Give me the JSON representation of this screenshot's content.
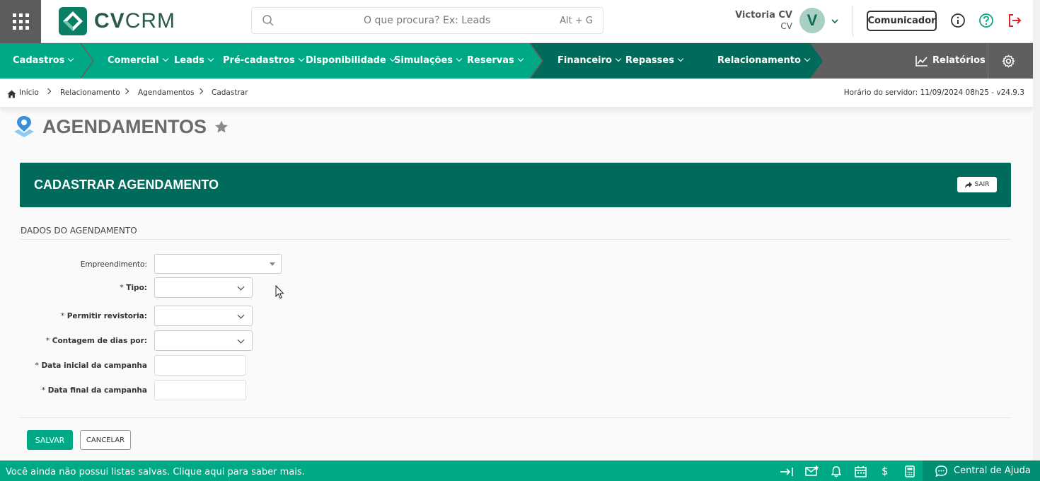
{
  "header": {
    "logo_bold": "CV",
    "logo_light": "CRM",
    "search_placeholder": "O que procura? Ex: Leads",
    "search_shortcut": "Alt + G",
    "user_name": "Victoria CV",
    "user_sub": "CV",
    "avatar_letter": "V",
    "comunicador_label": "Comunicador"
  },
  "nav": {
    "items": [
      {
        "label": "Cadastros"
      },
      {
        "label": "Comercial"
      },
      {
        "label": "Leads"
      },
      {
        "label": "Pré-cadastros"
      },
      {
        "label": "Disponibilidade"
      },
      {
        "label": "Simulações"
      },
      {
        "label": "Reservas"
      },
      {
        "label": "Financeiro"
      },
      {
        "label": "Repasses"
      },
      {
        "label": "Relacionamento"
      }
    ],
    "reports_label": "Relatórios"
  },
  "breadcrumb": {
    "items": [
      "Início",
      "Relacionamento",
      "Agendamentos",
      "Cadastrar"
    ],
    "server_time": "Horário do servidor: 11/09/2024 08h25 - v24.9.3"
  },
  "page": {
    "title": "AGENDAMENTOS"
  },
  "panel": {
    "title": "CADASTRAR AGENDAMENTO",
    "exit_label": "SAIR",
    "section_label": "DADOS DO AGENDAMENTO"
  },
  "form": {
    "empreendimento_label": "Empreendimento:",
    "tipo_label": "Tipo:",
    "revistoria_label": "Permitir revistoria:",
    "contagem_label": "Contagem de dias por:",
    "data_inicial_label": "Data inicial da campanha",
    "data_final_label": "Data final da campanha",
    "required_mark": "*",
    "empreendimento_value": "",
    "tipo_value": "",
    "revistoria_value": "",
    "contagem_value": "",
    "data_inicial_value": "",
    "data_final_value": "",
    "save_label": "SALVAR",
    "cancel_label": "CANCELAR"
  },
  "footer": {
    "message": "Você ainda não possui listas salvas. Clique aqui para saber mais.",
    "help_label": "Central de Ajuda"
  },
  "colors": {
    "brand_green": "#00a985",
    "dark_green": "#006b5a",
    "nav_gray": "#5f5f5f",
    "danger": "#e02424"
  }
}
